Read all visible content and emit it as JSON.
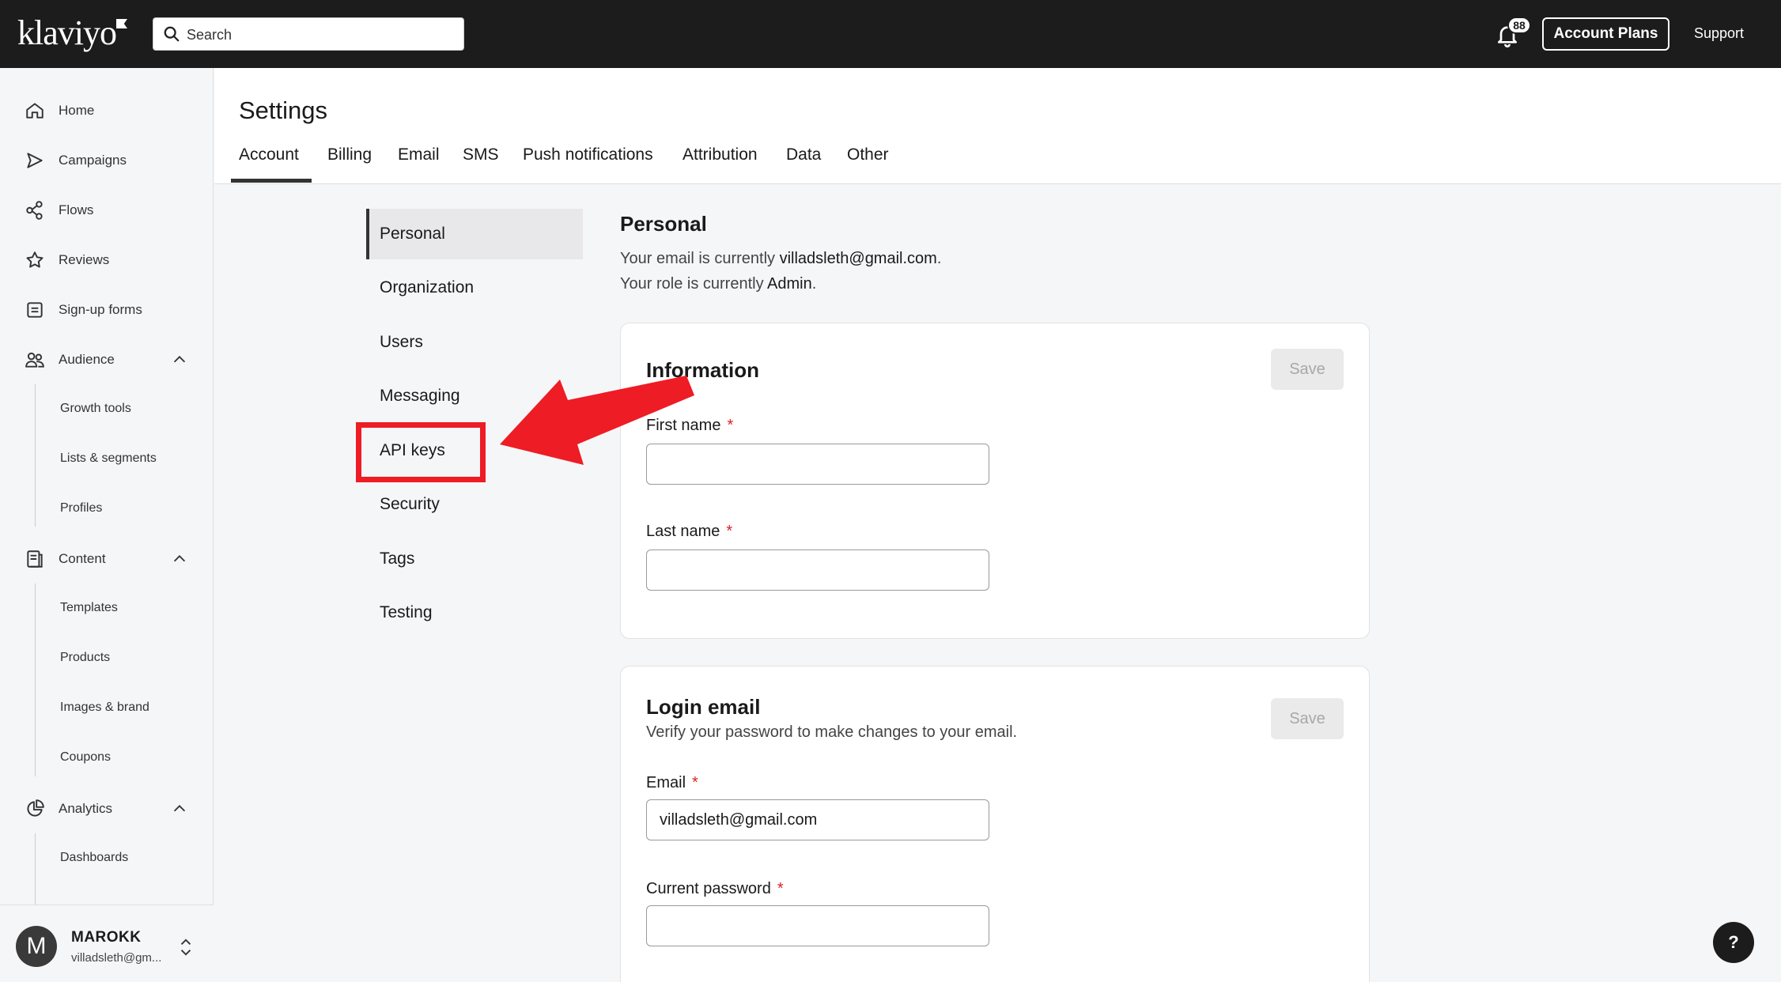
{
  "topbar": {
    "logo": "klaviyo",
    "search_placeholder": "Search",
    "notification_count": "88",
    "account_plans_label": "Account Plans",
    "support_label": "Support"
  },
  "sidebar": {
    "items": [
      {
        "label": "Home",
        "icon": "home-icon"
      },
      {
        "label": "Campaigns",
        "icon": "send-icon"
      },
      {
        "label": "Flows",
        "icon": "flows-icon"
      },
      {
        "label": "Reviews",
        "icon": "star-icon"
      },
      {
        "label": "Sign-up forms",
        "icon": "form-icon"
      },
      {
        "label": "Audience",
        "icon": "people-icon"
      },
      {
        "label": "Content",
        "icon": "content-icon"
      },
      {
        "label": "Analytics",
        "icon": "analytics-icon"
      }
    ],
    "audience_sub": [
      "Growth tools",
      "Lists & segments",
      "Profiles"
    ],
    "content_sub": [
      "Templates",
      "Products",
      "Images & brand",
      "Coupons"
    ],
    "analytics_sub": [
      "Dashboards"
    ],
    "user": {
      "initial": "M",
      "name": "MAROKK",
      "email": "villadsleth@gm..."
    }
  },
  "header": {
    "title": "Settings",
    "tabs": [
      "Account",
      "Billing",
      "Email",
      "SMS",
      "Push notifications",
      "Attribution",
      "Data",
      "Other"
    ],
    "active_tab": "Account"
  },
  "subnav": {
    "items": [
      "Personal",
      "Organization",
      "Users",
      "Messaging",
      "API keys",
      "Security",
      "Tags",
      "Testing"
    ],
    "active": "Personal",
    "highlighted": "API keys"
  },
  "personal": {
    "title": "Personal",
    "email_prefix": "Your email is currently ",
    "email_value": "villadsleth@gmail.com",
    "email_suffix": ".",
    "role_prefix": "Your role is currently ",
    "role_value": "Admin",
    "role_suffix": "."
  },
  "information_card": {
    "title": "Information",
    "save_label": "Save",
    "first_name_label": "First name",
    "first_name_value": "",
    "last_name_label": "Last name",
    "last_name_value": "",
    "required_mark": "*"
  },
  "login_card": {
    "title": "Login email",
    "description": "Verify your password to make changes to your email.",
    "save_label": "Save",
    "email_label": "Email",
    "email_value": "villadsleth@gmail.com",
    "password_label": "Current password",
    "password_value": "",
    "required_mark": "*"
  },
  "help_label": "?",
  "colors": {
    "topbar": "#1c1c1c",
    "annotation_red": "#ee1c24",
    "required": "#e02020"
  }
}
